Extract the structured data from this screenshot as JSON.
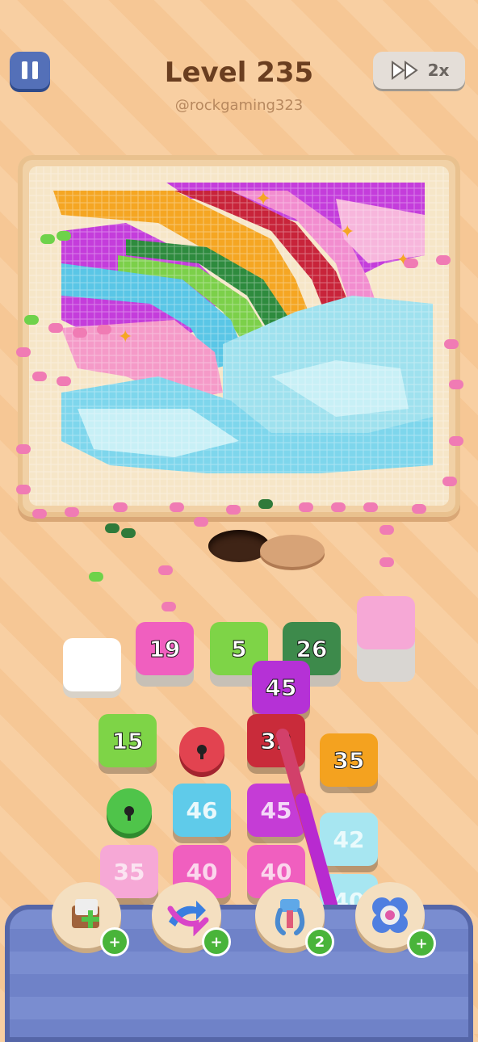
{
  "header": {
    "level_label": "Level 235",
    "username": "@rockgaming323",
    "speed_label": "2x"
  },
  "colors": {
    "pink": "#f05fbf",
    "green": "#7ed447",
    "dark_green": "#3d8a4b",
    "purple": "#b531d6",
    "red": "#c92b3a",
    "orange": "#f4a21f",
    "blue": "#5fcbea",
    "light_pink": "#f6a8d6",
    "light_blue": "#a7e6f1"
  },
  "queue_tiles": [
    {
      "value": "",
      "color": "#ffffff"
    },
    {
      "value": "19",
      "color": "#f05fbf"
    },
    {
      "value": "5",
      "color": "#7ed447"
    },
    {
      "value": "26",
      "color": "#3d8a4b"
    },
    {
      "value": "",
      "color": "#f6a8d6"
    }
  ],
  "grid_tiles": [
    {
      "value": "45",
      "color": "#b531d6"
    },
    {
      "value": "15",
      "color": "#7ed447"
    },
    {
      "value": "32",
      "color": "#c92b3a"
    },
    {
      "value": "35",
      "color": "#f4a21f"
    },
    {
      "value": "46",
      "color": "#5fcbea"
    },
    {
      "value": "45",
      "color": "#c53cd6"
    },
    {
      "value": "42",
      "color": "#a7e6f1"
    },
    {
      "value": "35",
      "color": "#f6a8d6"
    },
    {
      "value": "40",
      "color": "#f05fbf"
    },
    {
      "value": "40",
      "color": "#f05fbf"
    },
    {
      "value": "40",
      "color": "#a7e6f1"
    }
  ],
  "boosters": [
    {
      "icon": "add-box-icon",
      "badge": "+"
    },
    {
      "icon": "shuffle-arrows-icon",
      "badge": "+"
    },
    {
      "icon": "magnet-claw-icon",
      "badge": "2"
    },
    {
      "icon": "flower-button-icon",
      "badge": "+"
    }
  ]
}
